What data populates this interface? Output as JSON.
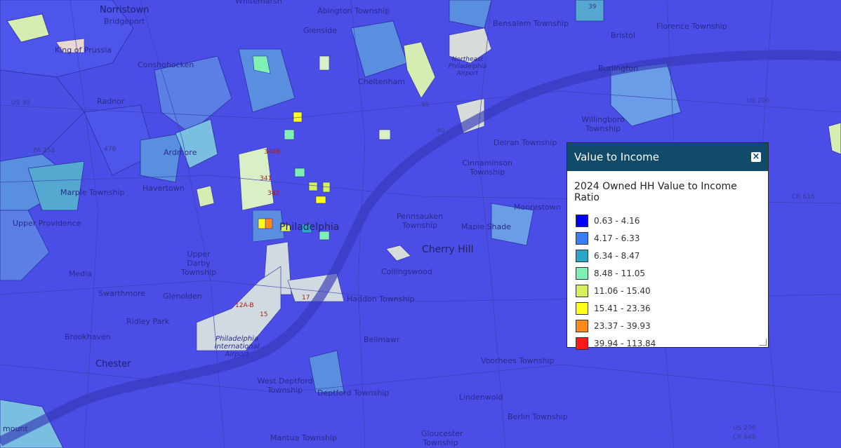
{
  "panel": {
    "title": "Value to Income",
    "subtitle": "2024 Owned HH Value to Income Ratio",
    "legend": [
      {
        "label": "0.63 - 4.16",
        "color": "#0000ff"
      },
      {
        "label": "4.17 - 6.33",
        "color": "#3d7cf4"
      },
      {
        "label": "6.34 - 8.47",
        "color": "#2aa6c6"
      },
      {
        "label": "8.48 - 11.05",
        "color": "#7ff0b4"
      },
      {
        "label": "11.06 - 15.40",
        "color": "#d4f05a"
      },
      {
        "label": "15.41 - 23.36",
        "color": "#ffff1a"
      },
      {
        "label": "23.37 - 39.93",
        "color": "#ff8a1a"
      },
      {
        "label": "39.94 - 113.84",
        "color": "#ff1a1a"
      }
    ]
  },
  "places": {
    "norristown": "Norristown",
    "bridgeport": "Bridgeport",
    "king_of_prussia": "King of Prussia",
    "conshohocken": "Conshohocken",
    "radnor": "Radnor",
    "ardmore": "Ardmore",
    "marple": "Marple Township",
    "upper_providence": "Upper Providence",
    "havertown": "Havertown",
    "upper_darby": "Upper Darby Township",
    "media": "Media",
    "swarthmore": "Swarthmore",
    "glenolden": "Glenolden",
    "ridley_park": "Ridley Park",
    "brookhaven": "Brookhaven",
    "chester": "Chester",
    "abington": "Abington Township",
    "glenside": "Glenside",
    "cheltenham": "Cheltenham",
    "bensalem": "Bensalem Township",
    "bristol": "Bristol",
    "florence": "Florence Township",
    "burlington": "Burlington",
    "willingboro": "Willingboro Township",
    "delran": "Delran Township",
    "cinnaminson": "Cinnaminson Township",
    "moorestown": "Moorestown",
    "pennsauken": "Pennsauken Township",
    "maple_shade": "Maple Shade",
    "cherry_hill": "Cherry Hill",
    "philadelphia": "Philadelphia",
    "collingswood": "Collingswood",
    "haddon": "Haddon Township",
    "bellmawr": "Bellmawr",
    "west_deptford": "West Deptford Township",
    "deptford": "Deptford Township",
    "voorhees": "Voorhees Township",
    "lindenwold": "Lindenwold",
    "berlin": "Berlin Township",
    "mantua": "Mantua Township",
    "gloucester": "Gloucester Township",
    "phl_airport": "Philadelphia International Airport",
    "ne_phila_airport": "Northeast Philadelphia Airport",
    "whitemarsh": "Whitemarsh",
    "mount": "mount"
  },
  "roads": {
    "us30": "US 30",
    "pa252": "PA 252",
    "us206": "US 206",
    "us206b": "US 206",
    "cr616": "CR 616",
    "cr648": "CR 648",
    "r476": "476",
    "r340b": "340B",
    "r341": "341",
    "r342": "342",
    "r12ab": "12A-B",
    "r15": "15",
    "r17": "17",
    "r39": "39",
    "r40": "40",
    "r95": "95"
  }
}
